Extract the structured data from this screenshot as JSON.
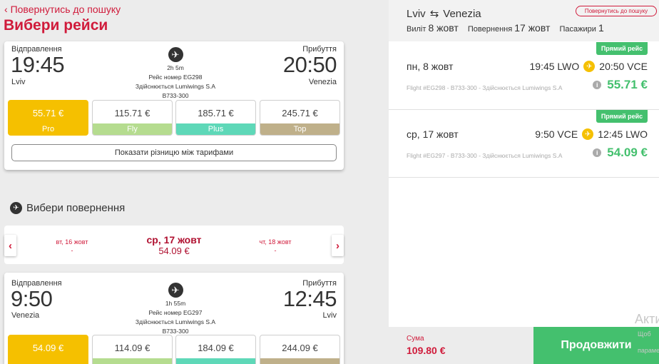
{
  "header": {
    "back_link": "Повернутись до пошуку",
    "title": "Вибери рейси"
  },
  "outbound": {
    "departure_label": "Відправлення",
    "arrival_label": "Прибуття",
    "dep_time": "19:45",
    "arr_time": "20:50",
    "dep_city": "Lviv",
    "arr_city": "Venezia",
    "duration": "2h 5m",
    "flight_number": "Рейс номер EG298",
    "operated_by": "Здійснюється Lumiwings S.A",
    "aircraft": "B733-300",
    "fares": [
      {
        "price": "55.71 €",
        "name": "Pro",
        "band_color": "#f5c000",
        "selected": true
      },
      {
        "price": "115.71 €",
        "name": "Fly",
        "band_color": "#b5dc8f",
        "selected": false
      },
      {
        "price": "185.71 €",
        "name": "Plus",
        "band_color": "#5ed8b8",
        "selected": false
      },
      {
        "price": "245.71 €",
        "name": "Top",
        "band_color": "#bfb08a",
        "selected": false
      }
    ],
    "diff_button": "Показати різницю між тарифами"
  },
  "return_section": {
    "heading": "Вибери повернення",
    "dates": [
      {
        "date": "вт, 16 жовт",
        "price": "-"
      },
      {
        "date": "ср, 17 жовт",
        "price": "54.09 €"
      },
      {
        "date": "чт, 18 жовт",
        "price": "-"
      }
    ]
  },
  "inbound": {
    "departure_label": "Відправлення",
    "arrival_label": "Прибуття",
    "dep_time": "9:50",
    "arr_time": "12:45",
    "dep_city": "Venezia",
    "arr_city": "Lviv",
    "duration": "1h 55m",
    "flight_number": "Рейс номер EG297",
    "operated_by": "Здійснюється Lumiwings S.A",
    "aircraft": "B733-300",
    "fares": [
      {
        "price": "54.09 €",
        "selected": true
      },
      {
        "price": "114.09 €",
        "selected": false
      },
      {
        "price": "184.09 €",
        "selected": false
      },
      {
        "price": "244.09 €",
        "selected": false
      }
    ]
  },
  "summary": {
    "from": "Lviv",
    "to": "Venezia",
    "back_pill": "Повернутись до пошуку",
    "depart_label": "Виліт",
    "depart_date": "8 жовт",
    "return_label": "Повернення",
    "return_date": "17 жовт",
    "passengers_label": "Пасажири",
    "passengers": "1",
    "flights": [
      {
        "badge": "Прямий рейс",
        "date": "пн, 8 жовт",
        "dep": "19:45 LWO",
        "arr": "20:50 VCE",
        "info": "Flight #EG298 - B733-300 - Здійснюється Lumiwings S.A",
        "price": "55.71 €"
      },
      {
        "badge": "Прямий рейс",
        "date": "ср, 17 жовт",
        "dep": "9:50 VCE",
        "arr": "12:45 LWO",
        "info": "Flight #EG297 - B733-300 - Здійснюється Lumiwings S.A",
        "price": "54.09 €"
      }
    ],
    "sum_label": "Сума",
    "sum_value": "109.80 €",
    "continue_label": "Продовжити"
  },
  "watermark": {
    "line1": "Акти",
    "line2": "Щоб",
    "line3": "параме"
  },
  "colors": {
    "brand_red": "#d01b3b",
    "accent_green": "#44c06e",
    "selected_yellow": "#f5c000"
  }
}
